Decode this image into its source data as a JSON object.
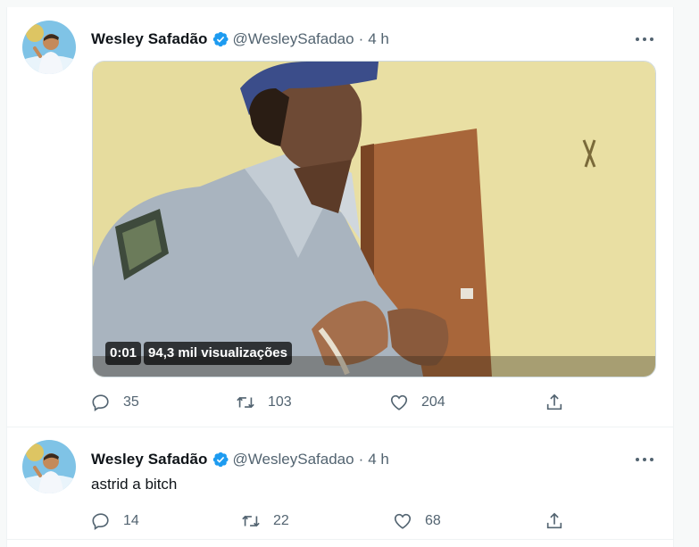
{
  "tweets": [
    {
      "author_name": "Wesley Safadão",
      "handle": "@WesleySafadao",
      "separator": "·",
      "time": "4 h",
      "text": "",
      "media": {
        "duration": "0:01",
        "views": "94,3 mil visualizações"
      },
      "replies": "35",
      "retweets": "103",
      "likes": "204"
    },
    {
      "author_name": "Wesley Safadão",
      "handle": "@WesleySafadao",
      "separator": "·",
      "time": "4 h",
      "text": "astrid a bitch",
      "replies": "14",
      "retweets": "22",
      "likes": "68"
    }
  ],
  "icons": {
    "reply": "reply-icon",
    "retweet": "retweet-icon",
    "like": "heart-icon",
    "share": "share-icon",
    "verified": "verified-badge-icon",
    "more": "more-options-icon"
  },
  "colors": {
    "verified": "#1d9bf0",
    "muted": "#536471",
    "border": "#eff3f4"
  }
}
